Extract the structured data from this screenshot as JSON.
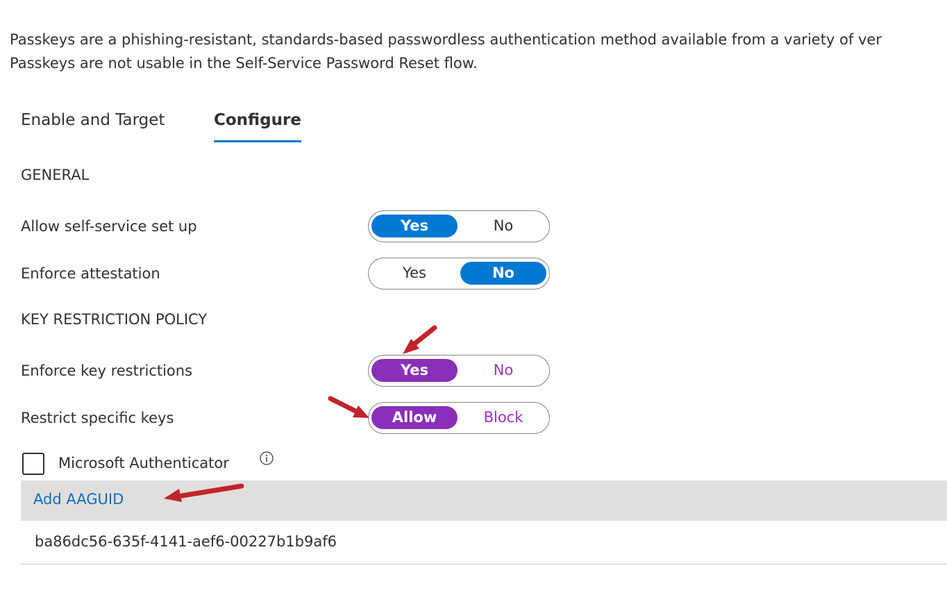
{
  "description": {
    "line1": "Passkeys are a phishing-resistant, standards-based passwordless authentication method available from a variety of ver",
    "line2": "Passkeys are not usable in the Self-Service Password Reset flow."
  },
  "tabs": [
    {
      "label": "Enable and Target",
      "active": false
    },
    {
      "label": "Configure",
      "active": true
    }
  ],
  "general": {
    "heading": "GENERAL",
    "allow_self_service": {
      "label": "Allow self-service set up",
      "yes": "Yes",
      "no": "No",
      "selected": "Yes"
    },
    "enforce_attestation": {
      "label": "Enforce attestation",
      "yes": "Yes",
      "no": "No",
      "selected": "No"
    }
  },
  "key_restriction": {
    "heading": "KEY RESTRICTION POLICY",
    "enforce_key_restrictions": {
      "label": "Enforce key restrictions",
      "yes": "Yes",
      "no": "No",
      "selected": "Yes"
    },
    "restrict_specific_keys": {
      "label": "Restrict specific keys",
      "allow": "Allow",
      "block": "Block",
      "selected": "Allow"
    }
  },
  "microsoft_authenticator": {
    "label": "Microsoft Authenticator",
    "checked": false,
    "icon": "info-icon"
  },
  "aaguid": {
    "add_label": "Add AAGUID",
    "values": [
      "ba86dc56-635f-4141-aef6-00227b1b9af6"
    ]
  },
  "colors": {
    "accent_blue": "#0078d4",
    "accent_purple": "#8a2fb8",
    "link": "#0f6cbd",
    "annotation_arrow": "#c0242b"
  }
}
